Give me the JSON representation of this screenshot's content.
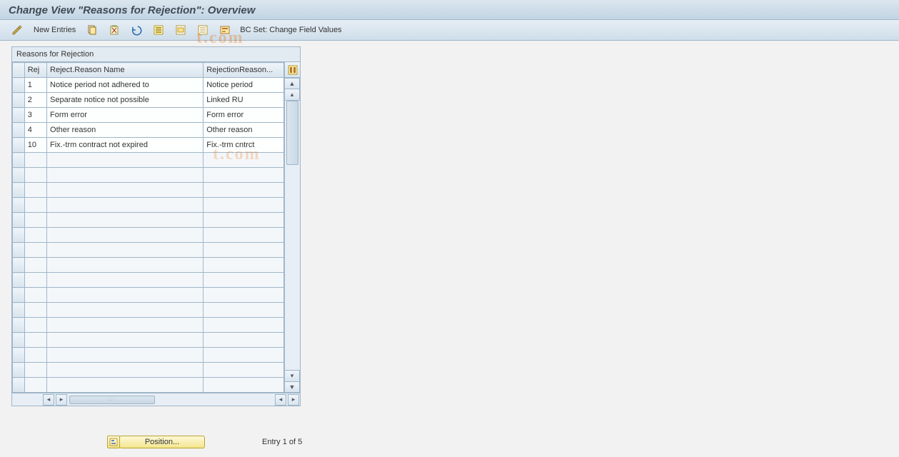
{
  "page_title": "Change View \"Reasons for Rejection\": Overview",
  "toolbar": {
    "new_entries": "New Entries",
    "bcset": "BC Set: Change Field Values"
  },
  "panel": {
    "caption": "Reasons for Rejection",
    "columns": {
      "rej": "Rej",
      "name": "Reject.Reason Name",
      "desc": "RejectionReason..."
    }
  },
  "rows": [
    {
      "rej": "1",
      "name": "Notice period not adhered to",
      "desc": "Notice period"
    },
    {
      "rej": "2",
      "name": "Separate notice not possible",
      "desc": "Linked RU"
    },
    {
      "rej": "3",
      "name": "Form error",
      "desc": "Form error"
    },
    {
      "rej": "4",
      "name": "Other reason",
      "desc": "Other reason"
    },
    {
      "rej": "10",
      "name": "Fix.-trm contract not expired",
      "desc": "Fix.-trm cntrct"
    }
  ],
  "empty_row_count": 16,
  "footer": {
    "position": "Position...",
    "entry_of": "Entry 1 of 5"
  },
  "watermark": "t.com"
}
